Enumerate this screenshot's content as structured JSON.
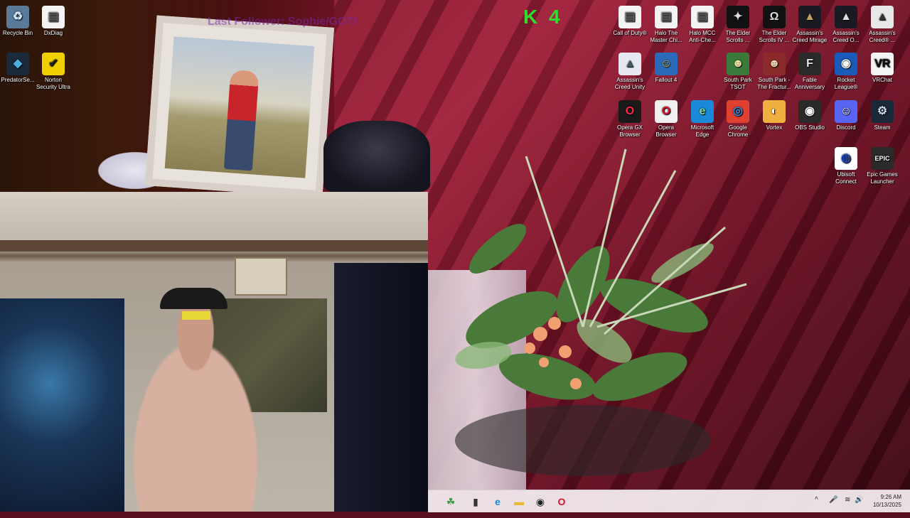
{
  "overlay": {
    "stream_text": "Last Follower: Sophie/GOTI",
    "stream_logo_text": "K 4"
  },
  "desktop_icons": [
    {
      "label": "Recycle Bin",
      "icon": "recycle-bin-icon",
      "symbol": "♻",
      "bg": "#5a7a9a",
      "fg": "#cfe6ff"
    },
    {
      "label": "DxDiag",
      "icon": "document-icon",
      "symbol": "▤",
      "bg": "#f4f4f4",
      "fg": "#666666"
    },
    {
      "label": "PredatorSe...",
      "icon": "predator-sense-icon",
      "symbol": "◆",
      "bg": "#1a2a3a",
      "fg": "#4ab0e0"
    },
    {
      "label": "Norton Security Ultra",
      "icon": "norton-icon",
      "symbol": "✔",
      "bg": "#f0d000",
      "fg": "#222222"
    },
    {
      "label": "Call of Duty®",
      "icon": "document-icon",
      "symbol": "▤",
      "bg": "#f4f4f4",
      "fg": "#666666"
    },
    {
      "label": "Halo The Master Chi...",
      "icon": "document-icon",
      "symbol": "▤",
      "bg": "#f4f4f4",
      "fg": "#666666"
    },
    {
      "label": "Halo MCC Anti-Che...",
      "icon": "document-icon",
      "symbol": "▤",
      "bg": "#f4f4f4",
      "fg": "#666666"
    },
    {
      "label": "The Elder Scrolls ...",
      "icon": "elder-scrolls-icon",
      "symbol": "✦",
      "bg": "#111111",
      "fg": "#dddddd"
    },
    {
      "label": "The Elder Scrolls IV ...",
      "icon": "elder-scrolls-icon",
      "symbol": "Ω",
      "bg": "#111111",
      "fg": "#dddddd"
    },
    {
      "label": "Assassin's Creed Mirage",
      "icon": "assassins-creed-icon",
      "symbol": "▲",
      "bg": "#1a1a22",
      "fg": "#c8a060"
    },
    {
      "label": "Assassin's Creed O...",
      "icon": "assassins-creed-icon",
      "symbol": "▲",
      "bg": "#1a1a22",
      "fg": "#e0e0e0"
    },
    {
      "label": "Assassin's Creed® ...",
      "icon": "assassins-creed-icon",
      "symbol": "▲",
      "bg": "#e8e8e8",
      "fg": "#333333"
    },
    {
      "label": "Assassin's Creed Unity",
      "icon": "assassins-creed-icon",
      "symbol": "▲",
      "bg": "#e8e8f0",
      "fg": "#445566"
    },
    {
      "label": "Fallout 4",
      "icon": "fallout-icon",
      "symbol": "☺",
      "bg": "#2a6ab8",
      "fg": "#f0c040"
    },
    {
      "label": "South Park TSOT",
      "icon": "south-park-icon",
      "symbol": "☻",
      "bg": "#3a7a3a",
      "fg": "#f0e0a0"
    },
    {
      "label": "South Park - The Fractur...",
      "icon": "south-park-icon",
      "symbol": "☻",
      "bg": "#8a2a2a",
      "fg": "#f0d0b0"
    },
    {
      "label": "Fable Anniversary",
      "icon": "fable-icon",
      "symbol": "F",
      "bg": "#2a2a2a",
      "fg": "#e8e8e8"
    },
    {
      "label": "Rocket League®",
      "icon": "rocket-league-icon",
      "symbol": "◉",
      "bg": "#1a5ab8",
      "fg": "#ffffff"
    },
    {
      "label": "VRChat",
      "icon": "vrchat-icon",
      "symbol": "VR",
      "bg": "#f4f4f4",
      "fg": "#111111"
    },
    {
      "label": "Opera GX Browser",
      "icon": "opera-gx-icon",
      "symbol": "O",
      "bg": "#1a1a1a",
      "fg": "#ff2a4a"
    },
    {
      "label": "Opera Browser",
      "icon": "opera-icon",
      "symbol": "O",
      "bg": "#f0f0f0",
      "fg": "#e0102a"
    },
    {
      "label": "Microsoft Edge",
      "icon": "edge-icon",
      "symbol": "e",
      "bg": "#1a8ad8",
      "fg": "#7ae0a0"
    },
    {
      "label": "Google Chrome",
      "icon": "chrome-icon",
      "symbol": "◎",
      "bg": "#e04030",
      "fg": "#2a8ae0"
    },
    {
      "label": "Vortex",
      "icon": "vortex-icon",
      "symbol": "◐",
      "bg": "#f0b040",
      "fg": "#ffffff"
    },
    {
      "label": "OBS Studio",
      "icon": "obs-icon",
      "symbol": "◉",
      "bg": "#2a2a2a",
      "fg": "#ffffff"
    },
    {
      "label": "Discord",
      "icon": "discord-icon",
      "symbol": "☺",
      "bg": "#5865f2",
      "fg": "#ffffff"
    },
    {
      "label": "Steam",
      "icon": "steam-icon",
      "symbol": "⚙",
      "bg": "#1b2838",
      "fg": "#c8d8e8"
    },
    {
      "label": "Ubisoft Connect",
      "icon": "ubisoft-icon",
      "symbol": "◍",
      "bg": "#ffffff",
      "fg": "#2a4ab8"
    },
    {
      "label": "Epic Games Launcher",
      "icon": "epic-games-icon",
      "symbol": "EPIC",
      "bg": "#2a2a2a",
      "fg": "#ffffff"
    }
  ],
  "taskbar": {
    "items": [
      {
        "name": "widgets-button",
        "icon": "widgets-icon",
        "symbol": "☘"
      },
      {
        "name": "task-view-button",
        "icon": "task-view-icon",
        "symbol": "▮"
      },
      {
        "name": "edge-taskbar-button",
        "icon": "edge-icon",
        "symbol": "e"
      },
      {
        "name": "file-explorer-button",
        "icon": "folder-icon",
        "symbol": "▬"
      },
      {
        "name": "obs-taskbar-button",
        "icon": "obs-icon",
        "symbol": "◉"
      },
      {
        "name": "opera-taskbar-button",
        "icon": "opera-icon",
        "symbol": "O"
      }
    ],
    "tray": {
      "chevron": "^",
      "mic": "🎤",
      "wifi": "≋",
      "volume": "🔊"
    },
    "time": "9:26 AM",
    "date": "10/13/2025"
  }
}
